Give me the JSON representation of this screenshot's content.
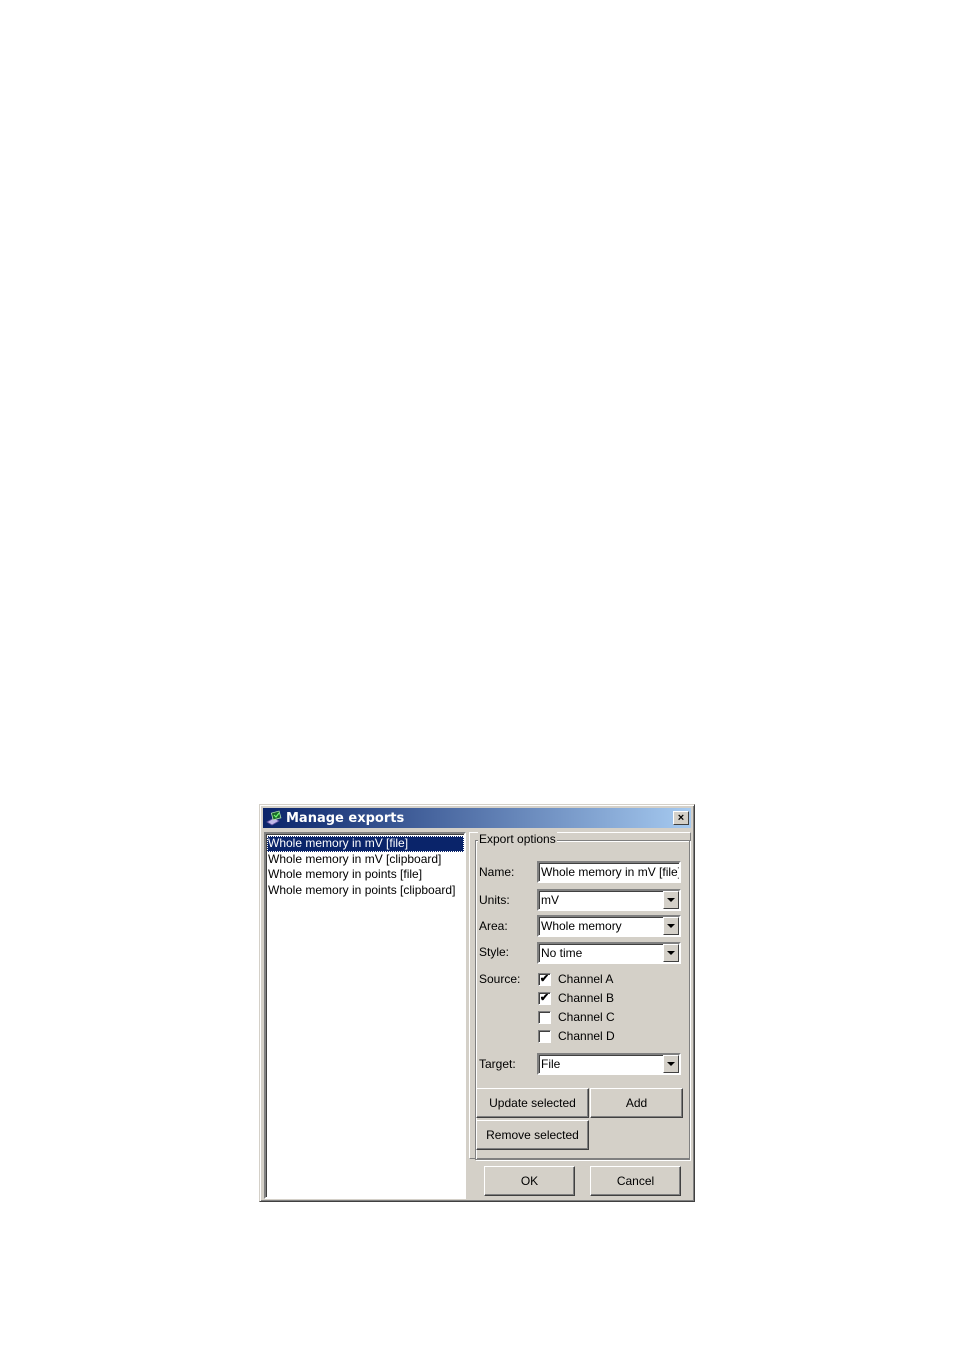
{
  "window": {
    "title": "Manage exports",
    "close_label": "×"
  },
  "export_list": {
    "items": [
      {
        "label": "Whole memory in mV [file]",
        "selected": true
      },
      {
        "label": "Whole memory in mV [clipboard]",
        "selected": false
      },
      {
        "label": "Whole memory in points [file]",
        "selected": false
      },
      {
        "label": "Whole memory in points [clipboard]",
        "selected": false
      }
    ]
  },
  "options": {
    "group_label": "Export options",
    "name_label": "Name:",
    "name_value": "Whole memory in mV [file]",
    "units_label": "Units:",
    "units_value": "mV",
    "area_label": "Area:",
    "area_value": "Whole memory",
    "style_label": "Style:",
    "style_value": "No time",
    "source_label": "Source:",
    "channels": [
      {
        "label": "Channel A",
        "checked": true
      },
      {
        "label": "Channel B",
        "checked": true
      },
      {
        "label": "Channel C",
        "checked": false
      },
      {
        "label": "Channel D",
        "checked": false
      }
    ],
    "target_label": "Target:",
    "target_value": "File",
    "checkmark": "✔"
  },
  "buttons": {
    "update_selected": "Update selected",
    "add": "Add",
    "remove_selected": "Remove selected",
    "ok": "OK",
    "cancel": "Cancel"
  }
}
